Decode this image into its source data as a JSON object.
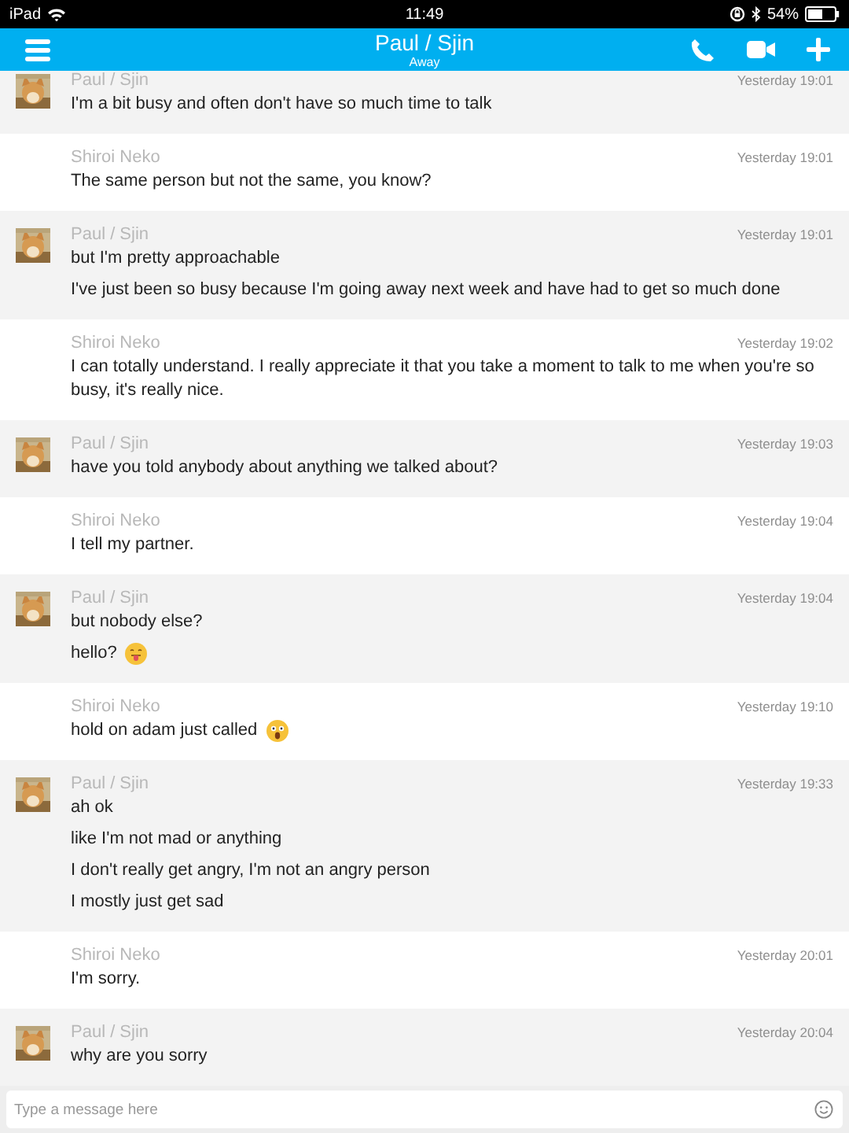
{
  "status_bar": {
    "device": "iPad",
    "time": "11:49",
    "battery": "54%"
  },
  "header": {
    "title": "Paul / Sjin",
    "status": "Away"
  },
  "messages": [
    {
      "kind": "contact",
      "sender": "Paul / Sjin",
      "time": "Yesterday 19:01",
      "lines": [
        {
          "text": "I'm a bit busy and often don't have so much time to talk"
        }
      ]
    },
    {
      "kind": "self",
      "sender": "Shiroi Neko",
      "time": "Yesterday 19:01",
      "lines": [
        {
          "text": "The same person but not the same, you know?"
        }
      ]
    },
    {
      "kind": "contact",
      "sender": "Paul / Sjin",
      "time": "Yesterday 19:01",
      "lines": [
        {
          "text": "but I'm pretty approachable"
        },
        {
          "text": "I've just been so busy because I'm going away next week and have had to get so much done"
        }
      ]
    },
    {
      "kind": "self",
      "sender": "Shiroi Neko",
      "time": "Yesterday 19:02",
      "lines": [
        {
          "text": "I can totally understand. I really appreciate it that you take a moment to talk to me when you're so busy, it's really nice."
        }
      ]
    },
    {
      "kind": "contact",
      "sender": "Paul / Sjin",
      "time": "Yesterday 19:03",
      "lines": [
        {
          "text": "have you told anybody about anything we talked about?"
        }
      ]
    },
    {
      "kind": "self",
      "sender": "Shiroi Neko",
      "time": "Yesterday 19:04",
      "lines": [
        {
          "text": "I tell my partner."
        }
      ]
    },
    {
      "kind": "contact",
      "sender": "Paul / Sjin",
      "time": "Yesterday 19:04",
      "lines": [
        {
          "text": "but nobody else?"
        },
        {
          "text": "hello?",
          "kind": "tongue"
        }
      ]
    },
    {
      "kind": "self",
      "sender": "Shiroi Neko",
      "time": "Yesterday 19:10",
      "lines": [
        {
          "text": "hold on adam just called",
          "kind": "shocked"
        }
      ]
    },
    {
      "kind": "contact",
      "sender": "Paul / Sjin",
      "time": "Yesterday 19:33",
      "lines": [
        {
          "text": "ah ok"
        },
        {
          "text": "like I'm not mad or anything"
        },
        {
          "text": "I don't really get angry, I'm not an angry person"
        },
        {
          "text": "I mostly just get sad"
        }
      ]
    },
    {
      "kind": "self",
      "sender": "Shiroi Neko",
      "time": "Yesterday 20:01",
      "lines": [
        {
          "text": "I'm sorry."
        }
      ]
    },
    {
      "kind": "contact",
      "sender": "Paul / Sjin",
      "time": "Yesterday 20:04",
      "lines": [
        {
          "text": "why are you sorry"
        }
      ]
    }
  ],
  "composer": {
    "placeholder": "Type a message here"
  }
}
